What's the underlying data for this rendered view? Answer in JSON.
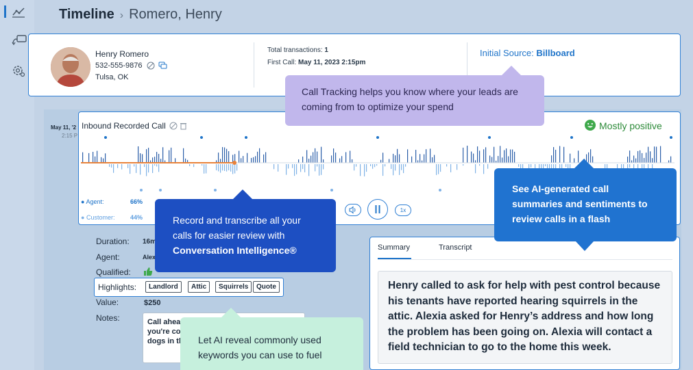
{
  "header": {
    "title": "Timeline",
    "separator": "›",
    "contact_name": "Romero, Henry"
  },
  "contact": {
    "name": "Henry Romero",
    "phone": "532-555-9876",
    "city": "Tulsa, OK",
    "total_transactions_label": "Total transactions:",
    "total_transactions_value": "1",
    "first_call_label": "First Call:",
    "first_call_value": "May 11, 2023 2:15pm",
    "initial_source_label": "Initial Source:",
    "initial_source_value": "Billboard"
  },
  "timeline": {
    "date": "May 11, '2",
    "time": "2:15 P"
  },
  "recording": {
    "title": "Inbound Recorded Call",
    "sentiment": "Mostly positive",
    "agent_label": "Agent:",
    "agent_pct": "66%",
    "customer_label": "Customer:",
    "customer_pct": "44%",
    "speed": "1x",
    "progress": 0.26
  },
  "details": {
    "duration_label": "Duration:",
    "duration_value": "16m",
    "agent_label": "Agent:",
    "agent_value": "Alex",
    "qualified_label": "Qualified:",
    "highlights_label": "Highlights:",
    "highlights": [
      "Landlord",
      "Attic",
      "Squirrels",
      "Quote"
    ],
    "value_label": "Value:",
    "value_value": "$250",
    "notes_label": "Notes:",
    "notes_lines": [
      "Call ahea",
      "you're co",
      "dogs in th"
    ]
  },
  "summary": {
    "tabs": [
      "Summary",
      "Transcript"
    ],
    "text": "Henry called to ask for help with pest control because his tenants have reported hearing squirrels in the attic. Alexia asked for Henry’s address and how long the problem has been going on. Alexia will contact a field technician to go to the home this week."
  },
  "callouts": {
    "call_tracking": "Call Tracking helps you know where your leads are coming from to optimize your spend",
    "record_line1": "Record and transcribe all your calls for easier review with",
    "record_bold": "Conversation Intelligence®",
    "ai_summary": "See AI-generated call summaries and sentiments to review calls in a flash",
    "keywords": "Let AI reveal commonly used keywords you can use to fuel"
  },
  "colors": {
    "accent": "#1f74c9",
    "positive": "#2e8b3a",
    "purple": "#c1b7ec",
    "navy": "#1d4fc2",
    "green": "#c6f0dd"
  },
  "icons": [
    "timeline-icon",
    "call-icon",
    "settings-icon",
    "block-icon",
    "chat-icon",
    "smiley-icon",
    "delete-icon"
  ]
}
